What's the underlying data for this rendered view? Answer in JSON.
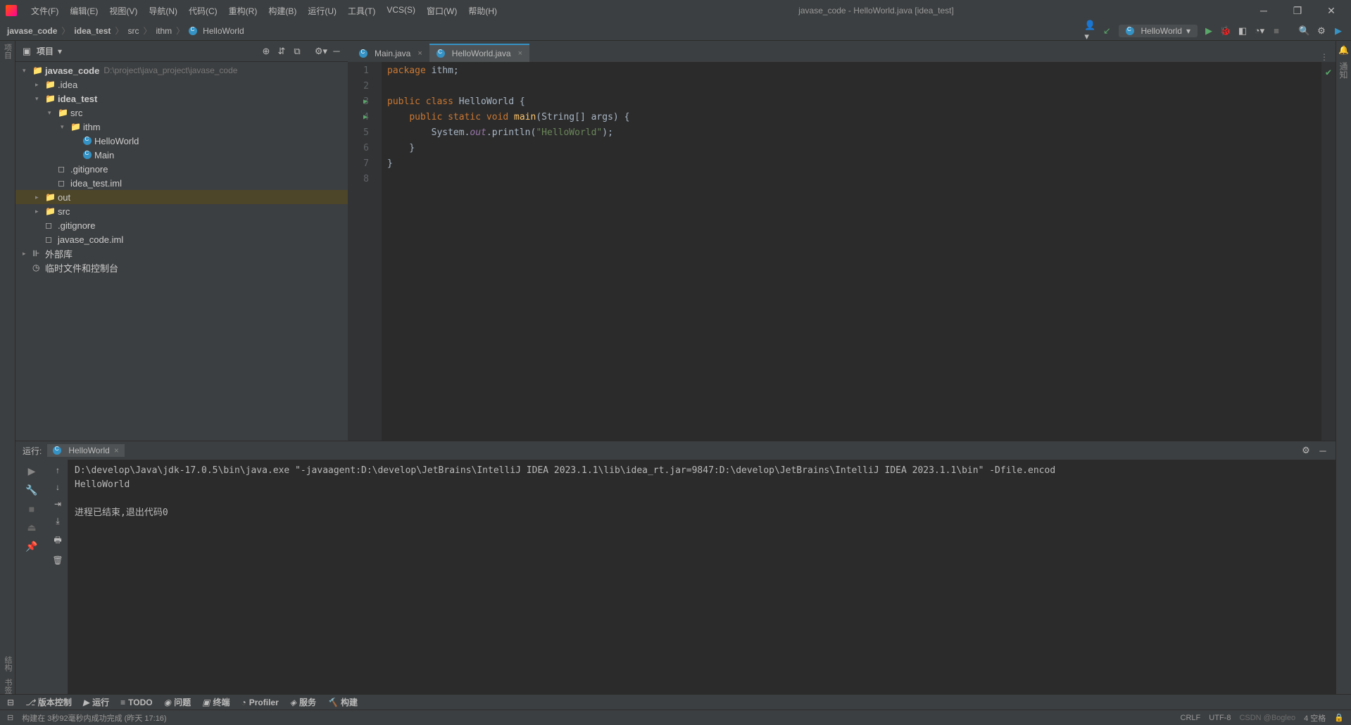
{
  "title": "javase_code - HelloWorld.java [idea_test]",
  "menus": [
    "文件(F)",
    "编辑(E)",
    "视图(V)",
    "导航(N)",
    "代码(C)",
    "重构(R)",
    "构建(B)",
    "运行(U)",
    "工具(T)",
    "VCS(S)",
    "窗口(W)",
    "帮助(H)"
  ],
  "crumbs": [
    "javase_code",
    "idea_test",
    "src",
    "ithm",
    "HelloWorld"
  ],
  "runcfg": "HelloWorld",
  "sidebar": {
    "title": "项目",
    "tree": [
      {
        "indent": 0,
        "arrow": "▾",
        "icon": "📁",
        "iconcls": "folder-blue",
        "label": "javase_code",
        "path": "D:\\project\\java_project\\javase_code",
        "bold": true
      },
      {
        "indent": 1,
        "arrow": "▸",
        "icon": "📁",
        "iconcls": "folder-yellow",
        "label": ".idea"
      },
      {
        "indent": 1,
        "arrow": "▾",
        "icon": "📁",
        "iconcls": "folder-blue",
        "label": "idea_test",
        "bold": true
      },
      {
        "indent": 2,
        "arrow": "▾",
        "icon": "📁",
        "iconcls": "folder-blue",
        "label": "src"
      },
      {
        "indent": 3,
        "arrow": "▾",
        "icon": "📁",
        "iconcls": "folder-blue",
        "label": "ithm"
      },
      {
        "indent": 4,
        "arrow": "",
        "icon": "C",
        "iconcls": "circ",
        "label": "HelloWorld"
      },
      {
        "indent": 4,
        "arrow": "",
        "icon": "C",
        "iconcls": "circ",
        "label": "Main"
      },
      {
        "indent": 2,
        "arrow": "",
        "icon": "◻",
        "iconcls": "",
        "label": ".gitignore"
      },
      {
        "indent": 2,
        "arrow": "",
        "icon": "◻",
        "iconcls": "",
        "label": "idea_test.iml"
      },
      {
        "indent": 1,
        "arrow": "▸",
        "icon": "📁",
        "iconcls": "folder-orange",
        "label": "out",
        "hl": true
      },
      {
        "indent": 1,
        "arrow": "▸",
        "icon": "📁",
        "iconcls": "folder-blue",
        "label": "src"
      },
      {
        "indent": 1,
        "arrow": "",
        "icon": "◻",
        "iconcls": "",
        "label": ".gitignore"
      },
      {
        "indent": 1,
        "arrow": "",
        "icon": "◻",
        "iconcls": "",
        "label": "javase_code.iml"
      },
      {
        "indent": 0,
        "arrow": "▸",
        "icon": "⊪",
        "iconcls": "",
        "label": "外部库"
      },
      {
        "indent": 0,
        "arrow": "",
        "icon": "◷",
        "iconcls": "",
        "label": "临时文件和控制台"
      }
    ]
  },
  "tabs": [
    {
      "label": "Main.java",
      "active": false
    },
    {
      "label": "HelloWorld.java",
      "active": true
    }
  ],
  "code": {
    "lines": [
      1,
      2,
      3,
      4,
      5,
      6,
      7,
      8
    ],
    "runmarks": [
      3,
      4
    ]
  },
  "run": {
    "label": "运行:",
    "tab": "HelloWorld",
    "cmd": "D:\\develop\\Java\\jdk-17.0.5\\bin\\java.exe \"-javaagent:D:\\develop\\JetBrains\\IntelliJ IDEA 2023.1.1\\lib\\idea_rt.jar=9847:D:\\develop\\JetBrains\\IntelliJ IDEA 2023.1.1\\bin\" -Dfile.encod",
    "out": "HelloWorld",
    "exit": "进程已结束,退出代码0"
  },
  "bottom": [
    "版本控制",
    "运行",
    "TODO",
    "问题",
    "终端",
    "Profiler",
    "服务",
    "构建"
  ],
  "bottomicons": [
    "⎇",
    "▶",
    "≡",
    "◉",
    "▣",
    "◔",
    "◈",
    "🔨"
  ],
  "status": {
    "build": "构建在 3秒92毫秒内成功完成 (昨天 17:16)",
    "crlf": "CRLF",
    "enc": "UTF-8",
    "ind": "4 空格",
    "watermark": "CSDN @Bogleo"
  },
  "leftgutter": [
    "项目",
    "结构",
    "书签"
  ],
  "rightgutter": [
    "🔔",
    "通知"
  ]
}
